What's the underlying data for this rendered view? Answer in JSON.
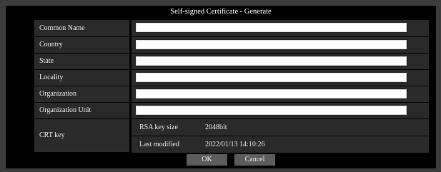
{
  "title": "Self-signed Certificate - Generate",
  "fields": [
    {
      "label": "Common Name",
      "value": ""
    },
    {
      "label": "Country",
      "value": ""
    },
    {
      "label": "State",
      "value": ""
    },
    {
      "label": "Locality",
      "value": ""
    },
    {
      "label": "Organization",
      "value": ""
    },
    {
      "label": "Organization Unit",
      "value": ""
    }
  ],
  "crt_key": {
    "label": "CRT key",
    "rows": [
      {
        "label": "RSA key size",
        "value": "2048bit"
      },
      {
        "label": "Last modified",
        "value": "2022/01/13 14:10:26"
      }
    ]
  },
  "buttons": {
    "ok": "OK",
    "cancel": "Cancel"
  }
}
